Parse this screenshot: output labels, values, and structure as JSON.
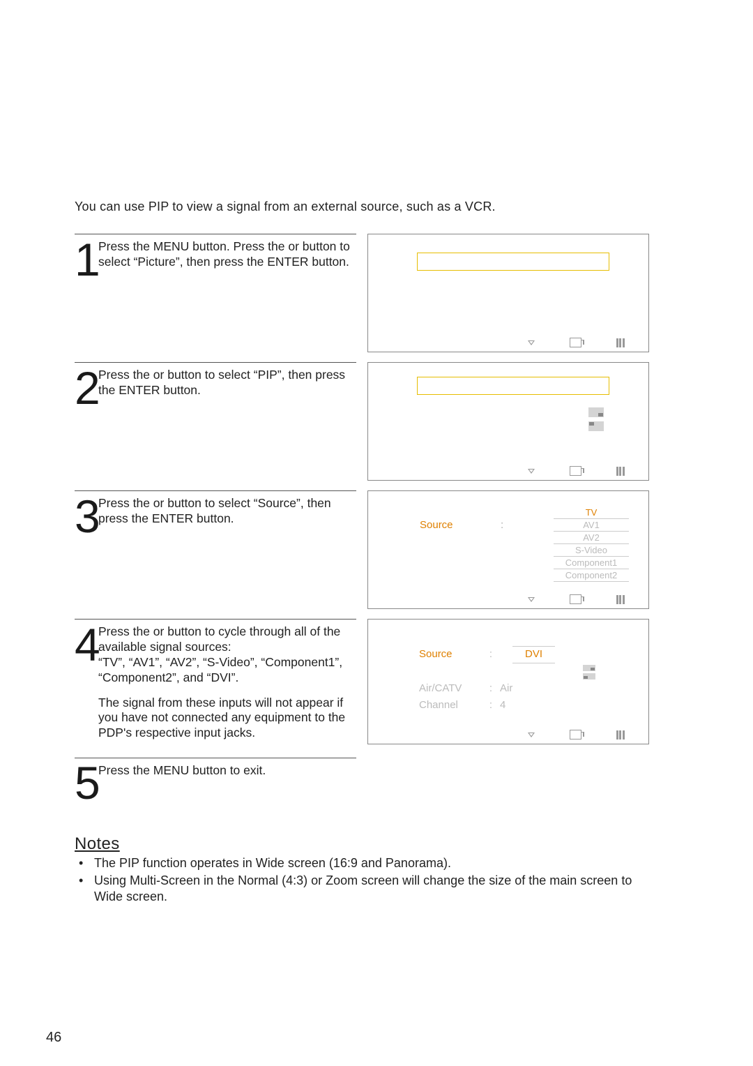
{
  "intro": "You can use PIP to view a signal from an external source, such as a VCR.",
  "steps": [
    {
      "num": "1",
      "text": "Press the MENU button. Press the     or     button to select “Picture”, then press the ENTER button."
    },
    {
      "num": "2",
      "text": "Press the     or     button to select “PIP”, then press the ENTER button."
    },
    {
      "num": "3",
      "text": "Press the     or     button to select “Source”, then press the ENTER button."
    },
    {
      "num": "4",
      "text1": "Press the     or     button to cycle through all of the available signal sources:",
      "text2": "“TV”, “AV1”, “AV2”, “S-Video”, “Component1”, “Component2”, and “DVI”.",
      "text3": "The signal from these inputs will not appear if you have not connected any equipment to the PDP's respective input jacks."
    },
    {
      "num": "5",
      "text": "Press the MENU button to exit."
    }
  ],
  "osd3": {
    "leftLabel": "Source",
    "selected": "TV",
    "options": [
      "TV",
      "AV1",
      "AV2",
      "S-Video",
      "Component1",
      "Component2"
    ]
  },
  "osd4": {
    "rows": [
      {
        "label": "Source",
        "value": "DVI",
        "highlightLabel": true,
        "highlightValue": true,
        "underlineValue": true
      },
      {
        "label": "",
        "value": "",
        "iconset": true
      },
      {
        "label": "Air/CATV",
        "value": "Air"
      },
      {
        "label": "Channel",
        "value": "4"
      }
    ]
  },
  "notes": {
    "title": "Notes",
    "items": [
      "The PIP function operates in Wide screen (16:9 and Panorama).",
      "Using Multi-Screen in the Normal (4:3) or Zoom screen will change the size of the main screen to Wide screen."
    ]
  },
  "pageNumber": "46"
}
